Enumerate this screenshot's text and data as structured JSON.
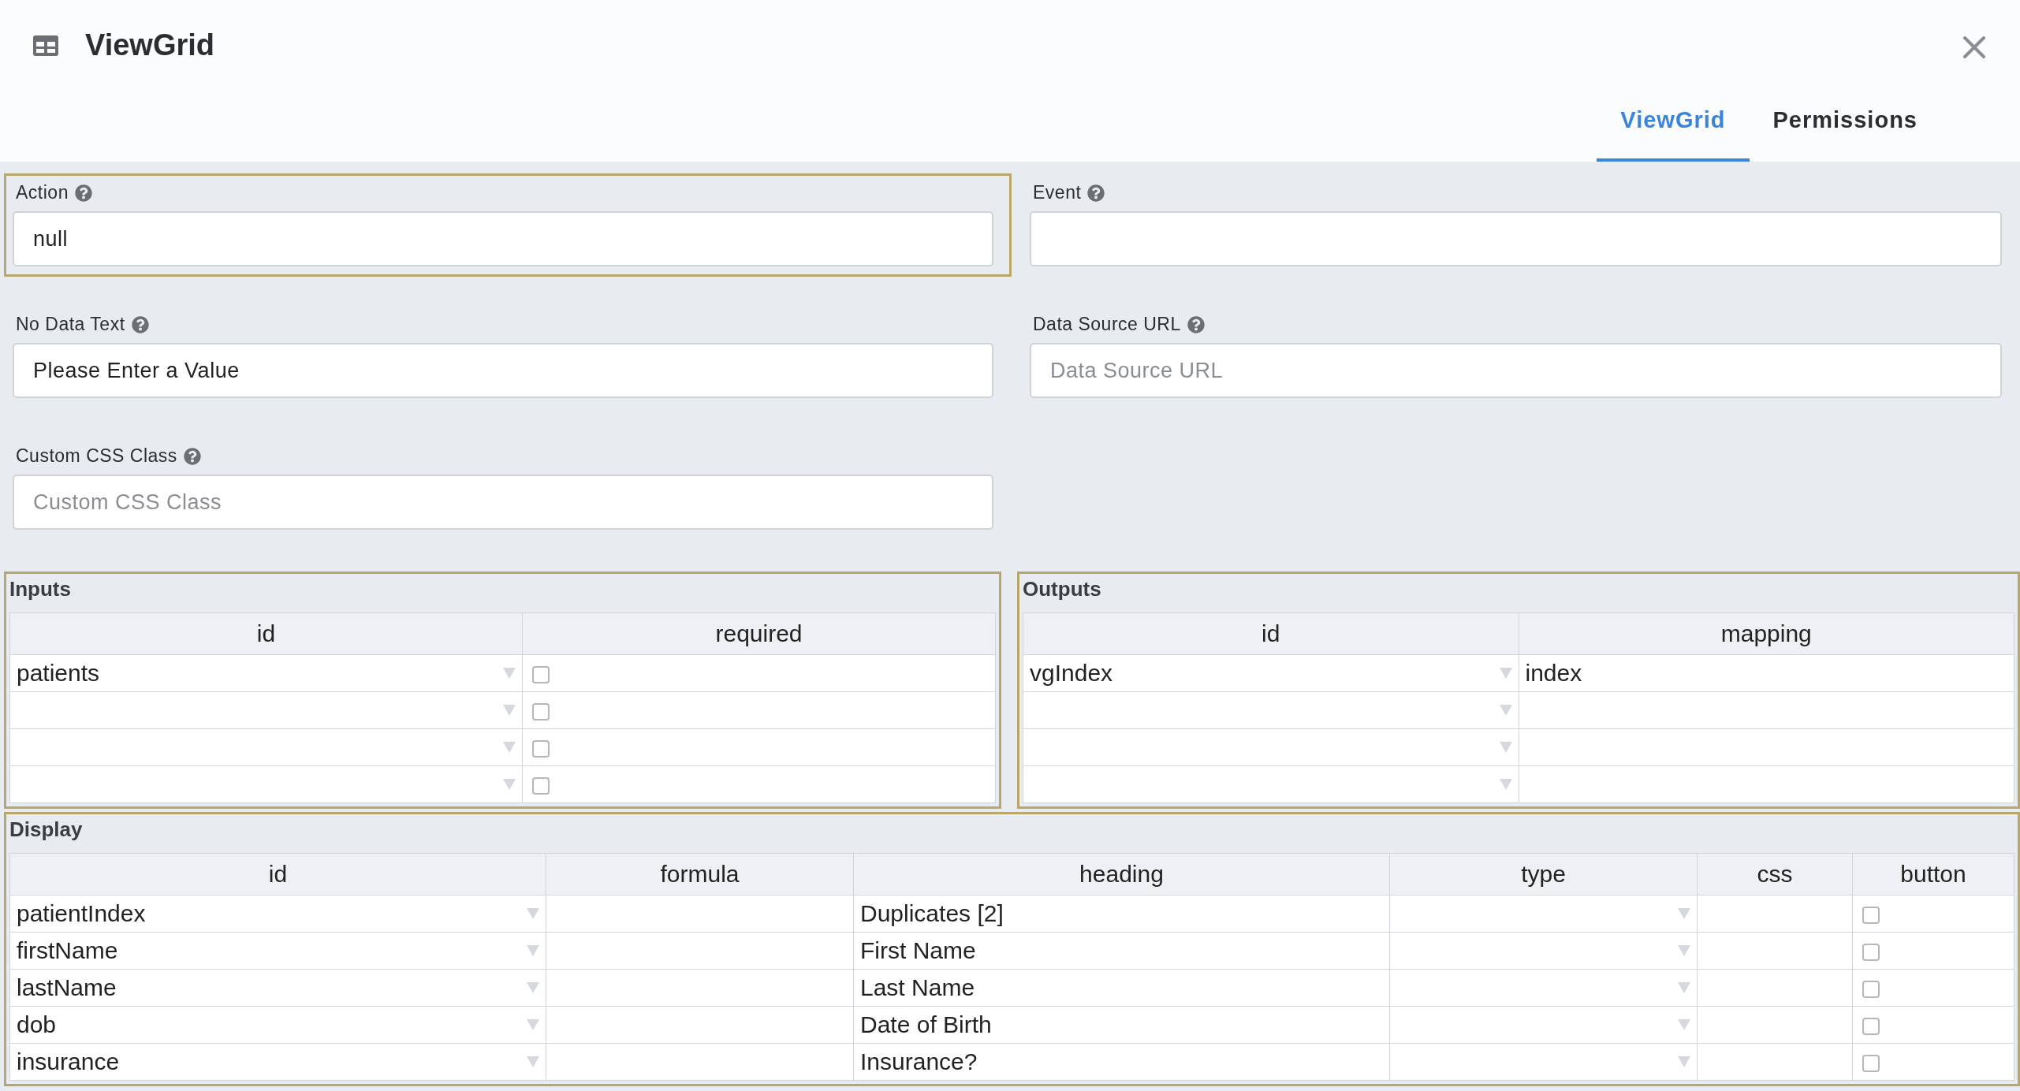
{
  "dialog": {
    "title": "ViewGrid"
  },
  "tabs": [
    {
      "label": "ViewGrid",
      "selected": true
    },
    {
      "label": "Permissions",
      "selected": false
    }
  ],
  "fields": [
    {
      "label": "Action",
      "value": "null",
      "highlighted": true
    },
    {
      "label": "Event",
      "highlighted": false
    },
    {
      "label": "No Data Text",
      "value": "Please Enter a Value",
      "highlighted": false
    },
    {
      "label": "Data Source URL",
      "placeholder": "Data Source URL",
      "highlighted": false
    },
    {
      "label": "Custom CSS Class",
      "placeholder": "Custom CSS Class",
      "highlighted": false
    }
  ],
  "inputs": {
    "title": "Inputs",
    "columns": [
      "id",
      "required"
    ],
    "rows": [
      {
        "id": "patients",
        "required": false
      },
      {
        "required": false
      },
      {
        "required": false
      },
      {
        "required": false
      }
    ]
  },
  "outputs": {
    "title": "Outputs",
    "columns": [
      "id",
      "mapping"
    ],
    "rows": [
      {
        "id": "vgIndex",
        "mapping": "index"
      },
      {},
      {},
      {}
    ]
  },
  "display": {
    "title": "Display",
    "columns": [
      "id",
      "formula",
      "heading",
      "type",
      "css",
      "button"
    ],
    "rows": [
      {
        "id": "patientIndex",
        "heading": "Duplicates [2]",
        "button": false
      },
      {
        "id": "firstName",
        "heading": "First Name",
        "button": false
      },
      {
        "id": "lastName",
        "heading": "Last Name",
        "button": false
      },
      {
        "id": "dob",
        "heading": "Date of Birth",
        "button": false
      },
      {
        "id": "insurance",
        "heading": "Insurance?",
        "button": false
      }
    ]
  }
}
